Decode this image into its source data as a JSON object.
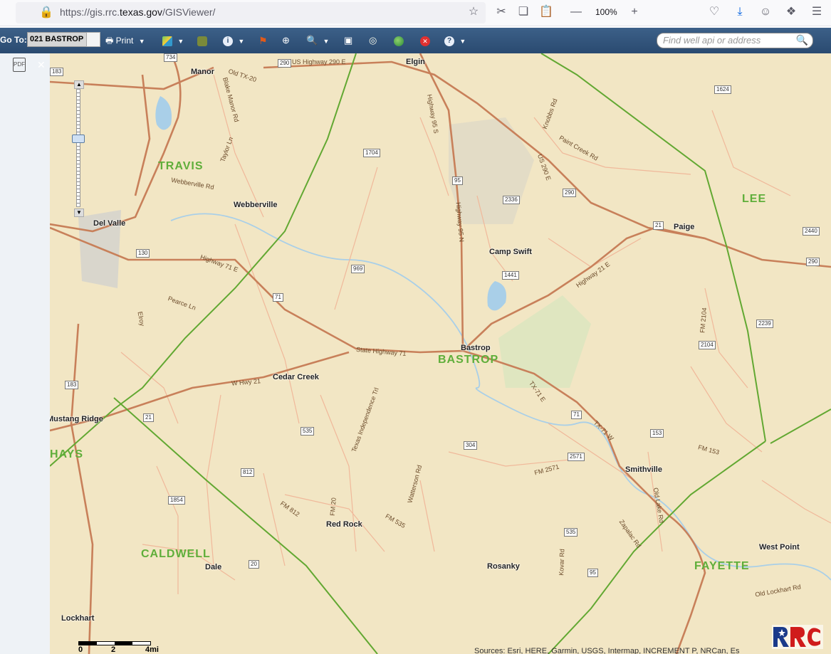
{
  "browser": {
    "url_prefix": "https://gis.rrc.",
    "url_domain": "texas.gov",
    "url_suffix": "/GISViewer/",
    "zoom": "100%"
  },
  "toolbar": {
    "goto_label": "Go To:",
    "goto_value": "021 BASTROP",
    "print_label": "Print",
    "search_placeholder": "Find well api or address"
  },
  "map": {
    "counties": [
      {
        "name": "TRAVIS"
      },
      {
        "name": "BASTROP"
      },
      {
        "name": "LEE"
      },
      {
        "name": "CALDWELL"
      },
      {
        "name": "FAYETTE"
      },
      {
        "name": "HAYS"
      }
    ],
    "places": [
      {
        "name": "Manor"
      },
      {
        "name": "Elgin"
      },
      {
        "name": "Webberville"
      },
      {
        "name": "Del Valle"
      },
      {
        "name": "Camp Swift"
      },
      {
        "name": "Paige"
      },
      {
        "name": "Bastrop"
      },
      {
        "name": "Cedar Creek"
      },
      {
        "name": "Mustang Ridge"
      },
      {
        "name": "Smithville"
      },
      {
        "name": "Red Rock"
      },
      {
        "name": "Rosanky"
      },
      {
        "name": "Dale"
      },
      {
        "name": "West Point"
      },
      {
        "name": "Lockhart"
      }
    ],
    "roads": [
      {
        "name": "US Highway 290 E"
      },
      {
        "name": "Old TX-20"
      },
      {
        "name": "Highway 71 E"
      },
      {
        "name": "State Highway 71"
      },
      {
        "name": "W Hwy 21"
      },
      {
        "name": "Highway 21 E"
      },
      {
        "name": "Highway 95 S"
      },
      {
        "name": "Highway 95 N"
      },
      {
        "name": "Texas Independence Trl"
      },
      {
        "name": "FM 812"
      },
      {
        "name": "FM 535"
      },
      {
        "name": "FM 20"
      },
      {
        "name": "FM 2571"
      },
      {
        "name": "FM 153"
      },
      {
        "name": "FM 2104"
      },
      {
        "name": "Webberville Rd"
      },
      {
        "name": "Old Lockhart Rd"
      },
      {
        "name": "Watterson Rd"
      },
      {
        "name": "Kovar Rd"
      },
      {
        "name": "Zapalac Rd"
      },
      {
        "name": "Old Lake Rd"
      },
      {
        "name": "Paint Creek Rd"
      },
      {
        "name": "Knobbs Rd"
      },
      {
        "name": "US 290 E"
      },
      {
        "name": "TX-71 E"
      },
      {
        "name": "TX-71 W"
      },
      {
        "name": "Pearce Ln"
      },
      {
        "name": "Elroy"
      },
      {
        "name": "Taylor Ln"
      },
      {
        "name": "Blake Manor Rd"
      }
    ],
    "shields": [
      {
        "label": "290"
      },
      {
        "label": "1704"
      },
      {
        "label": "95"
      },
      {
        "label": "2336"
      },
      {
        "label": "290"
      },
      {
        "label": "21"
      },
      {
        "label": "130"
      },
      {
        "label": "969"
      },
      {
        "label": "1441"
      },
      {
        "label": "71"
      },
      {
        "label": "183"
      },
      {
        "label": "21"
      },
      {
        "label": "535"
      },
      {
        "label": "304"
      },
      {
        "label": "812"
      },
      {
        "label": "71"
      },
      {
        "label": "2571"
      },
      {
        "label": "153"
      },
      {
        "label": "1854"
      },
      {
        "label": "535"
      },
      {
        "label": "95"
      },
      {
        "label": "20"
      },
      {
        "label": "1624"
      },
      {
        "label": "2440"
      },
      {
        "label": "290"
      },
      {
        "label": "2239"
      },
      {
        "label": "2104"
      },
      {
        "label": "183"
      },
      {
        "label": "734"
      }
    ],
    "scale_labels": [
      "0",
      "2",
      "4mi"
    ],
    "attribution": "Sources: Esri, HERE, Garmin, USGS, Intermap, INCREMENT P, NRCan, Es",
    "colors": {
      "county_line": "#62a832",
      "major_road": "#c8805a",
      "minor_road": "#f0b89a",
      "water": "#a9cfe8",
      "background": "#f2e6c4"
    }
  }
}
